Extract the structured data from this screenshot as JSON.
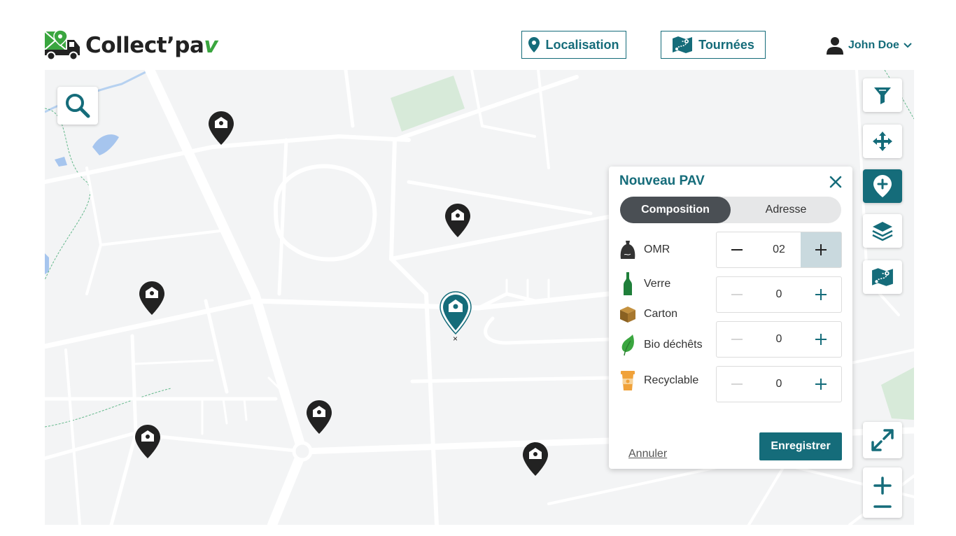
{
  "app": {
    "name": "Collect’pa",
    "name_suffix": "v"
  },
  "nav": {
    "localisation_label": "Localisation",
    "tournees_label": "Tournées"
  },
  "user": {
    "name": "John Doe"
  },
  "map": {
    "new_marker_label": "×"
  },
  "panel": {
    "title": "Nouveau PAV",
    "tabs": [
      {
        "label": "Composition",
        "active": true
      },
      {
        "label": "Adresse",
        "active": false
      }
    ],
    "rows": [
      {
        "label": "OMR",
        "value": "02",
        "icon": "trash-bag-icon"
      },
      {
        "label": "Verre",
        "value": "0",
        "icon": "glass-bottle-icon"
      },
      {
        "label": "Carton",
        "value": "0",
        "icon": "cardboard-box-icon"
      },
      {
        "label": "Bio déchêts",
        "value": "0",
        "icon": "leaf-icon"
      },
      {
        "label": "Recyclable",
        "value": "0",
        "icon": "paper-cup-icon"
      }
    ],
    "cancel_label": "Annuler",
    "save_label": "Enregistrer"
  },
  "colors": {
    "accent": "#156c7a",
    "logo_green": "#3aa63f",
    "map_bg": "#f3f4f5",
    "tab_active": "#4a4f54"
  }
}
